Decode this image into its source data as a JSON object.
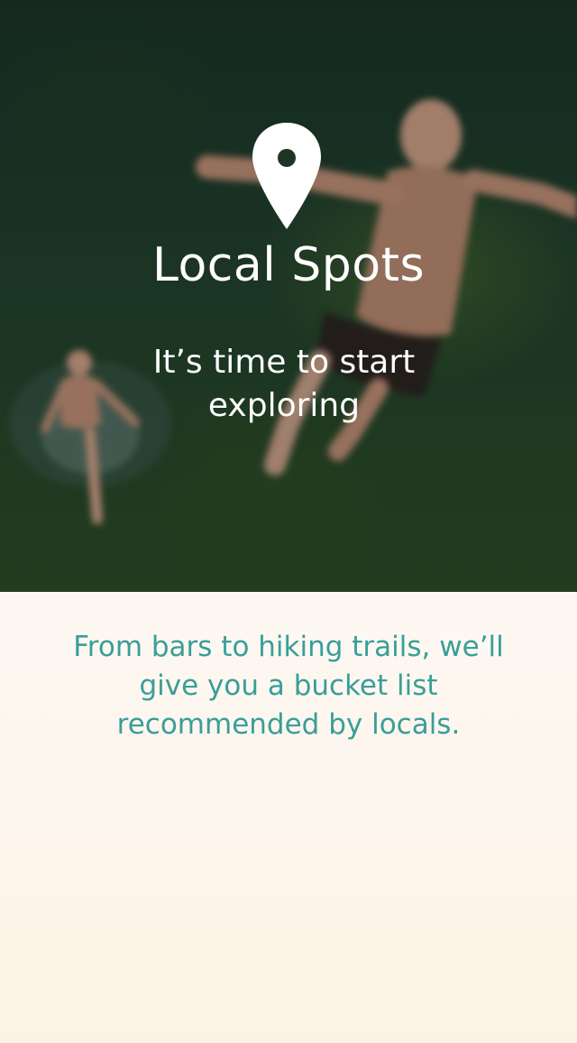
{
  "hero": {
    "icon": "location-pin-icon",
    "title": "Local Spots",
    "tagline": "It’s time to start exploring"
  },
  "panel": {
    "description": "From bars to hiking trails, we’ll give you a bucket list recommended by locals."
  },
  "colors": {
    "accent": "#3a9e98",
    "panel_background": "#fdf3e6",
    "hero_text": "#ffffff"
  }
}
